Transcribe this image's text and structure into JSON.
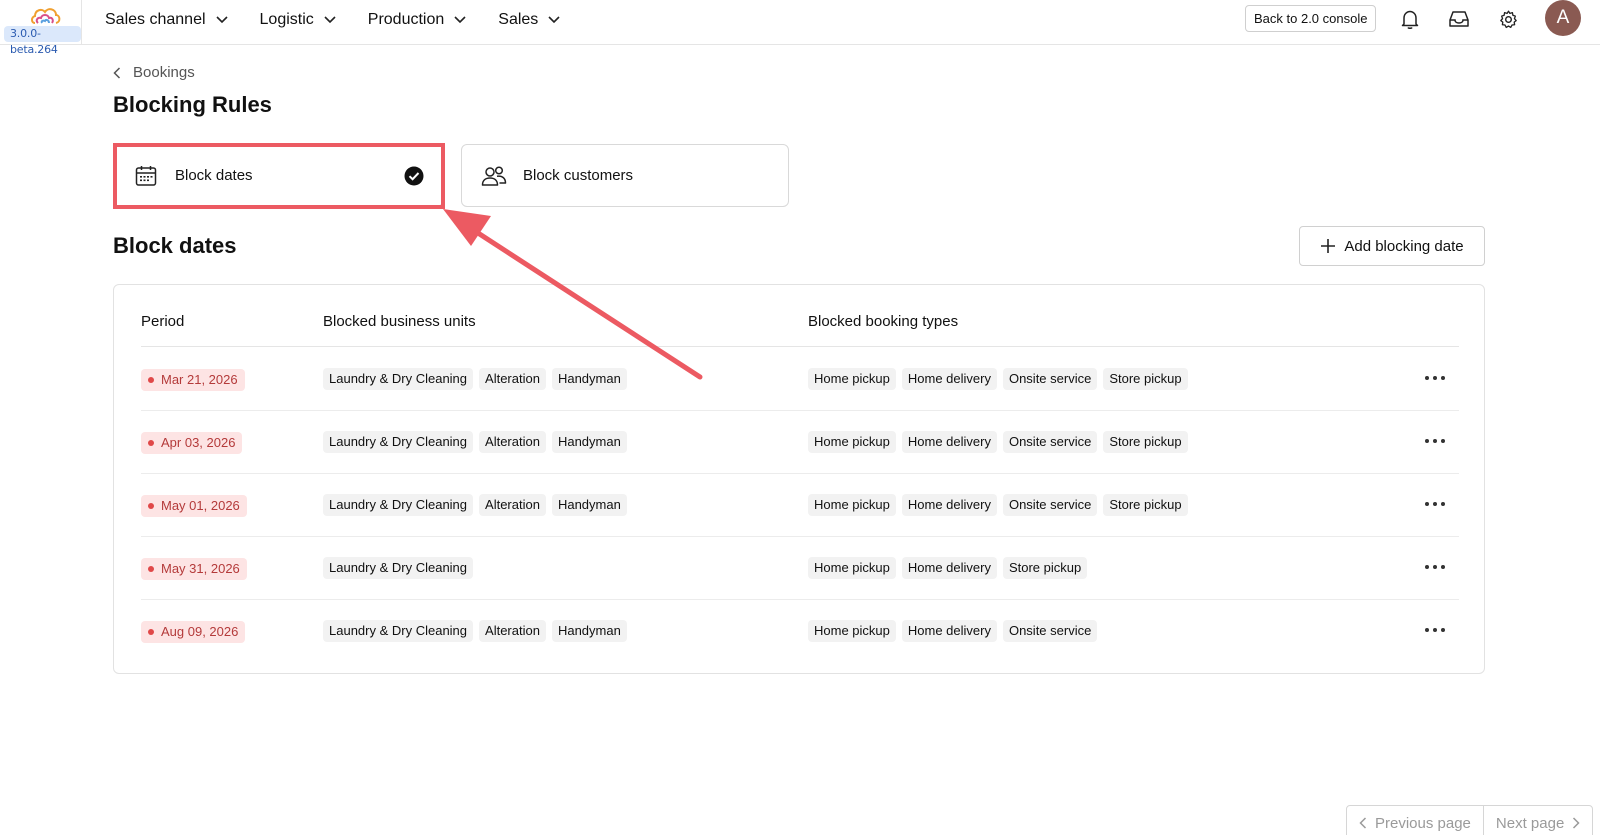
{
  "topbar": {
    "version": "3.0.0-beta.264",
    "nav": [
      {
        "label": "Sales channel"
      },
      {
        "label": "Logistic"
      },
      {
        "label": "Production"
      },
      {
        "label": "Sales"
      }
    ],
    "back_label": "Back to 2.0 console",
    "avatar_initial": "A",
    "icons": [
      "bell-icon",
      "inbox-icon",
      "gear-icon"
    ]
  },
  "breadcrumb": {
    "label": "Bookings"
  },
  "page_title": "Blocking Rules",
  "cards": {
    "dates": {
      "label": "Block dates",
      "icon": "calendar-icon",
      "selected": true
    },
    "customers": {
      "label": "Block customers",
      "icon": "users-icon",
      "selected": false
    }
  },
  "section": {
    "title": "Block dates",
    "add_label": "Add blocking date"
  },
  "table": {
    "headers": {
      "period": "Period",
      "units": "Blocked business units",
      "types": "Blocked booking types"
    },
    "rows": [
      {
        "period": "Mar 21, 2026",
        "units": [
          "Laundry & Dry Cleaning",
          "Alteration",
          "Handyman"
        ],
        "types": [
          "Home pickup",
          "Home delivery",
          "Onsite service",
          "Store pickup"
        ]
      },
      {
        "period": "Apr 03, 2026",
        "units": [
          "Laundry & Dry Cleaning",
          "Alteration",
          "Handyman"
        ],
        "types": [
          "Home pickup",
          "Home delivery",
          "Onsite service",
          "Store pickup"
        ]
      },
      {
        "period": "May 01, 2026",
        "units": [
          "Laundry & Dry Cleaning",
          "Alteration",
          "Handyman"
        ],
        "types": [
          "Home pickup",
          "Home delivery",
          "Onsite service",
          "Store pickup"
        ]
      },
      {
        "period": "May 31, 2026",
        "units": [
          "Laundry & Dry Cleaning"
        ],
        "types": [
          "Home pickup",
          "Home delivery",
          "Store pickup"
        ]
      },
      {
        "period": "Aug 09, 2026",
        "units": [
          "Laundry & Dry Cleaning",
          "Alteration",
          "Handyman"
        ],
        "types": [
          "Home pickup",
          "Home delivery",
          "Onsite service"
        ]
      }
    ]
  },
  "pager": {
    "prev_label": "Previous page",
    "next_label": "Next page"
  },
  "colors": {
    "highlight": "#ec5a62",
    "period_bg": "#fde4e4",
    "period_text": "#b43a3a"
  }
}
